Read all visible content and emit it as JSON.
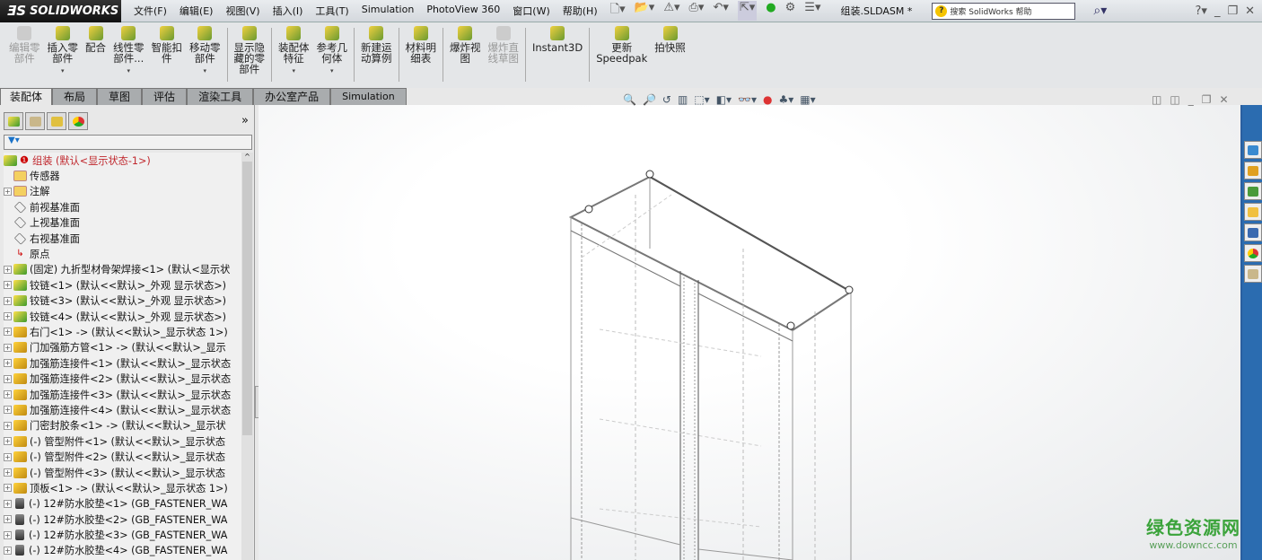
{
  "app": {
    "logo": "SOLIDWORKS",
    "doc_title": "组装.SLDASM *",
    "search_placeholder": "搜索 SolidWorks 帮助"
  },
  "menu": [
    "文件(F)",
    "编辑(E)",
    "视图(V)",
    "插入(I)",
    "工具(T)",
    "Simulation",
    "PhotoView 360",
    "窗口(W)",
    "帮助(H)"
  ],
  "commands": [
    {
      "label": "编辑零\n部件",
      "disabled": true,
      "dropdown": false
    },
    {
      "label": "插入零\n部件",
      "disabled": false,
      "dropdown": true
    },
    {
      "label": "配合",
      "disabled": false,
      "dropdown": false
    },
    {
      "label": "线性零\n部件...",
      "disabled": false,
      "dropdown": true
    },
    {
      "label": "智能扣\n件",
      "disabled": false,
      "dropdown": false
    },
    {
      "label": "移动零\n部件",
      "disabled": false,
      "dropdown": true
    },
    {
      "label": "显示隐\n藏的零\n部件",
      "disabled": false,
      "dropdown": false
    },
    {
      "label": "装配体\n特征",
      "disabled": false,
      "dropdown": true
    },
    {
      "label": "参考几\n何体",
      "disabled": false,
      "dropdown": true
    },
    {
      "label": "新建运\n动算例",
      "disabled": false,
      "dropdown": false
    },
    {
      "label": "材料明\n细表",
      "disabled": false,
      "dropdown": false
    },
    {
      "label": "爆炸视\n图",
      "disabled": false,
      "dropdown": false
    },
    {
      "label": "爆炸直\n线草图",
      "disabled": true,
      "dropdown": false
    },
    {
      "label": "Instant3D",
      "disabled": false,
      "dropdown": false
    },
    {
      "label": "更新\nSpeedpak",
      "disabled": false,
      "dropdown": false
    },
    {
      "label": "拍快照",
      "disabled": false,
      "dropdown": false
    }
  ],
  "tabs": [
    "装配体",
    "布局",
    "草图",
    "评估",
    "渲染工具",
    "办公室产品",
    "Simulation"
  ],
  "active_tab": "装配体",
  "tree": {
    "root": "组装  (默认<显示状态-1>)",
    "items": [
      {
        "text": "传感器",
        "icon": "fld",
        "exp": false
      },
      {
        "text": "注解",
        "icon": "fld",
        "exp": true
      },
      {
        "text": "前视基准面",
        "icon": "pln",
        "exp": false
      },
      {
        "text": "上视基准面",
        "icon": "pln",
        "exp": false
      },
      {
        "text": "右视基准面",
        "icon": "pln",
        "exp": false
      },
      {
        "text": "原点",
        "icon": "org",
        "exp": false
      },
      {
        "text": "(固定) 九折型材骨架焊接<1> (默认<显示状",
        "icon": "asm",
        "exp": true
      },
      {
        "text": "铰链<1> (默认<<默认>_外观 显示状态>)",
        "icon": "asm",
        "exp": true
      },
      {
        "text": "铰链<3> (默认<<默认>_外观 显示状态>)",
        "icon": "asm",
        "exp": true
      },
      {
        "text": "铰链<4> (默认<<默认>_外观 显示状态>)",
        "icon": "asm",
        "exp": true
      },
      {
        "text": "右门<1> -> (默认<<默认>_显示状态 1>)",
        "icon": "prt",
        "exp": true
      },
      {
        "text": "门加强筋方管<1> -> (默认<<默认>_显示",
        "icon": "prt",
        "exp": true
      },
      {
        "text": "加强筋连接件<1> (默认<<默认>_显示状态",
        "icon": "prt",
        "exp": true
      },
      {
        "text": "加强筋连接件<2> (默认<<默认>_显示状态",
        "icon": "prt",
        "exp": true
      },
      {
        "text": "加强筋连接件<3> (默认<<默认>_显示状态",
        "icon": "prt",
        "exp": true
      },
      {
        "text": "加强筋连接件<4> (默认<<默认>_显示状态",
        "icon": "prt",
        "exp": true
      },
      {
        "text": "门密封胶条<1> -> (默认<<默认>_显示状",
        "icon": "prt",
        "exp": true
      },
      {
        "text": "(-) 管型附件<1> (默认<<默认>_显示状态",
        "icon": "prt",
        "exp": true
      },
      {
        "text": "(-) 管型附件<2> (默认<<默认>_显示状态",
        "icon": "prt",
        "exp": true
      },
      {
        "text": "(-) 管型附件<3> (默认<<默认>_显示状态",
        "icon": "prt",
        "exp": true
      },
      {
        "text": "顶板<1> -> (默认<<默认>_显示状态 1>)",
        "icon": "prt",
        "exp": true
      },
      {
        "text": "(-) 12#防水胶垫<1> (GB_FASTENER_WA",
        "icon": "scr",
        "exp": true
      },
      {
        "text": "(-) 12#防水胶垫<2> (GB_FASTENER_WA",
        "icon": "scr",
        "exp": true
      },
      {
        "text": "(-) 12#防水胶垫<3> (GB_FASTENER_WA",
        "icon": "scr",
        "exp": true
      },
      {
        "text": "(-) 12#防水胶垫<4> (GB_FASTENER_WA",
        "icon": "scr",
        "exp": true
      }
    ]
  },
  "watermark": {
    "title": "绿色资源网",
    "url": "www.downcc.com"
  }
}
